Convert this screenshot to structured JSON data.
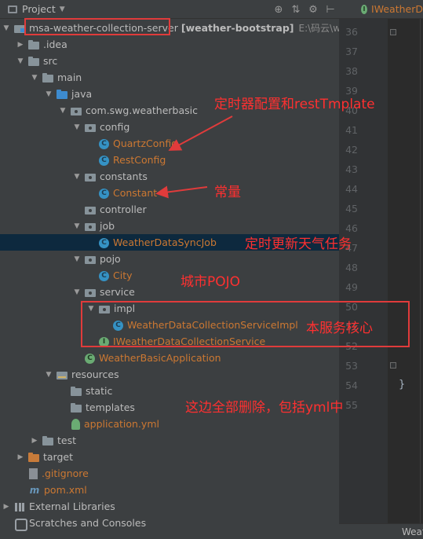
{
  "toolbar": {
    "title": "Project",
    "icons": [
      "target-icon",
      "collapse-icon",
      "gear-icon",
      "hide-icon"
    ]
  },
  "editor": {
    "tab_label": "IWeatherD",
    "line_numbers": [
      "36",
      "37",
      "38",
      "39",
      "40",
      "41",
      "42",
      "43",
      "44",
      "45",
      "46",
      "47",
      "48",
      "49",
      "50",
      "51",
      "52",
      "53",
      "54",
      "55"
    ],
    "closing_brace": "}",
    "status_text": "Weat"
  },
  "tree": {
    "root_name": "msa-weather-collection-server",
    "root_module": "[weather-bootstrap]",
    "root_path": "E:\\码云\\weathe",
    "idea": ".idea",
    "src": "src",
    "main": "main",
    "java": "java",
    "package": "com.swg.weatherbasic",
    "config": "config",
    "quartz_config": "QuartzConfig",
    "rest_config": "RestConfig",
    "constants": "constants",
    "constant": "Constant",
    "controller": "controller",
    "job": "job",
    "sync_job": "WeatherDataSyncJob",
    "pojo": "pojo",
    "city": "City",
    "service": "service",
    "impl": "impl",
    "service_impl": "WeatherDataCollectionServiceImpl",
    "service_iface": "IWeatherDataCollectionService",
    "app": "WeatherBasicApplication",
    "resources": "resources",
    "static": "static",
    "templates": "templates",
    "app_yml": "application.yml",
    "test": "test",
    "target": "target",
    "gitignore": ".gitignore",
    "pom": "pom.xml",
    "external_libs": "External Libraries",
    "scratches": "Scratches and Consoles"
  },
  "annotations": {
    "timer_rest": "定时器配置和restTmplate",
    "constant_note": "常量",
    "job_note": "定时更新天气任务",
    "pojo_note": "城市POJO",
    "service_note": "本服务核心",
    "delete_note": "这边全部删除，包括yml中"
  },
  "colors": {
    "annotation": "#ff3030",
    "class_icon": "#3592c4",
    "java_file_text": "#cc7832",
    "selected_row": "#0d293e"
  }
}
